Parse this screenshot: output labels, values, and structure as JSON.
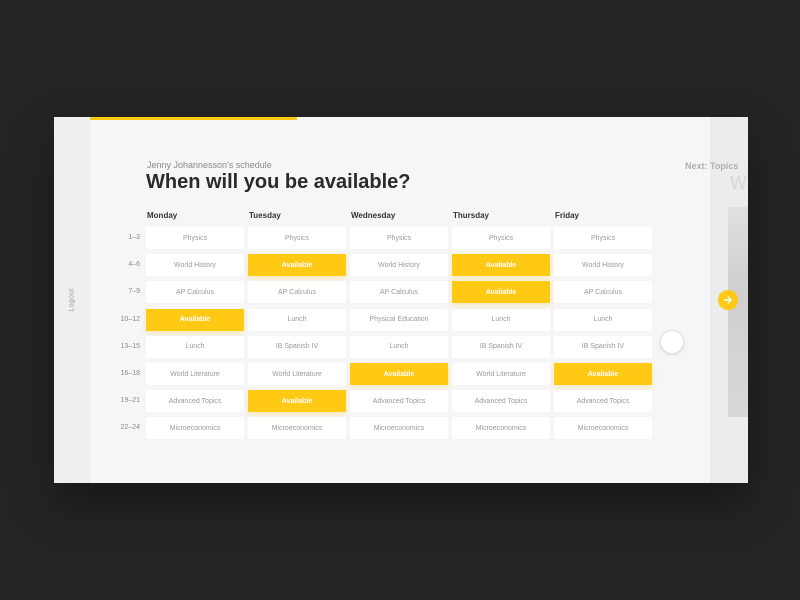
{
  "sidebar": {
    "logout_label": "Logout"
  },
  "header": {
    "subtitle": "Jenny Johannesson's schedule",
    "title": "When will you be available?"
  },
  "next": {
    "label": "Next: Topics",
    "peek_text": "W",
    "icon": "arrow-right-icon"
  },
  "colors": {
    "accent": "#ffc914",
    "background": "#f6f6f6",
    "cell": "#ffffff"
  },
  "schedule": {
    "days": [
      "Monday",
      "Tuesday",
      "Wednesday",
      "Thursday",
      "Friday"
    ],
    "times": [
      "1–3",
      "4–6",
      "7–9",
      "10–12",
      "13–15",
      "16–18",
      "19–21",
      "22–24"
    ],
    "rows": [
      [
        "Physics",
        "Physics",
        "Physics",
        "Physics",
        "Physics"
      ],
      [
        "World History",
        "Available",
        "World History",
        "Available",
        "World History"
      ],
      [
        "AP Calculus",
        "AP Calculus",
        "AP Calculus",
        "Available",
        "AP Calculus"
      ],
      [
        "Available",
        "Lunch",
        "Physical Education",
        "Lunch",
        "Lunch"
      ],
      [
        "Lunch",
        "IB Spanish IV",
        "Lunch",
        "IB Spanish IV",
        "IB Spanish IV"
      ],
      [
        "World Literature",
        "World Literature",
        "Available",
        "World Literature",
        "Available"
      ],
      [
        "Advanced Topics",
        "Available",
        "Advanced Topics",
        "Advanced Topics",
        "Advanced Topics"
      ],
      [
        "Microeconomics",
        "Microeconomics",
        "Microeconomics",
        "Microeconomics",
        "Microeconomics"
      ]
    ]
  }
}
